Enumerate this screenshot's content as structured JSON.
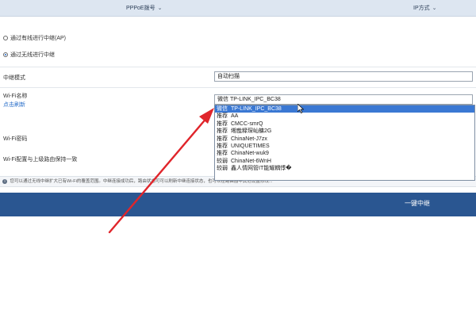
{
  "header": {
    "tab_pppoe": "PPPoE拨号",
    "tab_ip": "IP方式"
  },
  "mode_options": [
    {
      "label": "通过有线进行中继(AP)",
      "selected": false
    },
    {
      "label": "通过无线进行中继",
      "selected": true
    }
  ],
  "form": {
    "relay_mode_label": "中继模式",
    "relay_mode_value": "自动扫描",
    "wifi_name_label": "Wi-Fi名称",
    "refresh_link": "点击刷新",
    "wifi_name_value": "微信 TP-LINK_IPC_BC38",
    "wifi_password_label": "Wi-Fi密码",
    "wifi_sync_label": "Wi-Fi配置与上级路由保持一致"
  },
  "dropdown_items": [
    {
      "tag": "微信",
      "ssid": "TP-LINK_IPC_BC38",
      "selected": true
    },
    {
      "tag": "推荐",
      "ssid": "AA",
      "selected": false
    },
    {
      "tag": "推荐",
      "ssid": "CMCC-smrQ",
      "selected": false
    },
    {
      "tag": "推荐",
      "ssid": "缃戠粶琛屾槦2G",
      "selected": false
    },
    {
      "tag": "推荐",
      "ssid": "ChinaNet-J7zx",
      "selected": false
    },
    {
      "tag": "推荐",
      "ssid": "UNIQUETIMES",
      "selected": false
    },
    {
      "tag": "推荐",
      "ssid": "ChinaNet-wuk9",
      "selected": false
    },
    {
      "tag": "较弱",
      "ssid": "ChinaNet-6WnH",
      "selected": false
    },
    {
      "tag": "较弱",
      "ssid": "鑫人情网管IT能耀耦悸�",
      "selected": false
    }
  ],
  "info_text": "您可以通过无线中继扩大已有Wi-Fi的覆盖范围。中继连接成功后，路由状态可可以刷新中继连接状态，也可以在路由器中其他设置修改...",
  "action": {
    "one_click_label": "一键中继"
  },
  "colors": {
    "primary": "#2a5691",
    "highlight": "#3a78d3",
    "annotation_arrow": "#e0252b",
    "link": "#2a6fc9"
  }
}
